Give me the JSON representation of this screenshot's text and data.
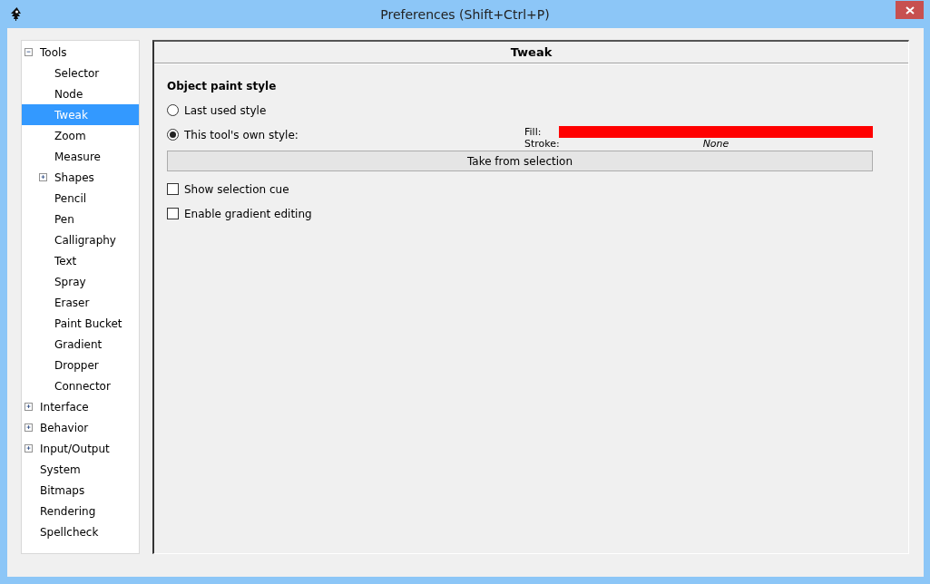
{
  "window": {
    "title": "Preferences (Shift+Ctrl+P)"
  },
  "tree": [
    {
      "label": "Tools",
      "selected": false,
      "expanded": true,
      "children": [
        {
          "label": "Selector",
          "selected": false
        },
        {
          "label": "Node",
          "selected": false
        },
        {
          "label": "Tweak",
          "selected": true
        },
        {
          "label": "Zoom",
          "selected": false
        },
        {
          "label": "Measure",
          "selected": false
        },
        {
          "label": "Shapes",
          "selected": false,
          "expanded": false
        },
        {
          "label": "Pencil",
          "selected": false
        },
        {
          "label": "Pen",
          "selected": false
        },
        {
          "label": "Calligraphy",
          "selected": false
        },
        {
          "label": "Text",
          "selected": false
        },
        {
          "label": "Spray",
          "selected": false
        },
        {
          "label": "Eraser",
          "selected": false
        },
        {
          "label": "Paint Bucket",
          "selected": false
        },
        {
          "label": "Gradient",
          "selected": false
        },
        {
          "label": "Dropper",
          "selected": false
        },
        {
          "label": "Connector",
          "selected": false
        }
      ]
    },
    {
      "label": "Interface",
      "selected": false,
      "expanded": false
    },
    {
      "label": "Behavior",
      "selected": false,
      "expanded": false
    },
    {
      "label": "Input/Output",
      "selected": false,
      "expanded": false
    },
    {
      "label": "System",
      "selected": false
    },
    {
      "label": "Bitmaps",
      "selected": false
    },
    {
      "label": "Rendering",
      "selected": false
    },
    {
      "label": "Spellcheck",
      "selected": false
    }
  ],
  "page": {
    "title": "Tweak",
    "section": "Object paint style",
    "radios": [
      {
        "label": "Last used style",
        "selected": false
      },
      {
        "label": "This tool's own style:",
        "selected": true
      }
    ],
    "style": {
      "fill_label": "Fill:",
      "fill_swatch": {
        "color": "#ff0000"
      },
      "stroke_label": "Stroke:",
      "stroke_value": "None"
    },
    "button": "Take from selection",
    "checkboxes": [
      {
        "label": "Show selection cue",
        "checked": false
      },
      {
        "label": "Enable gradient editing",
        "checked": false
      }
    ]
  }
}
